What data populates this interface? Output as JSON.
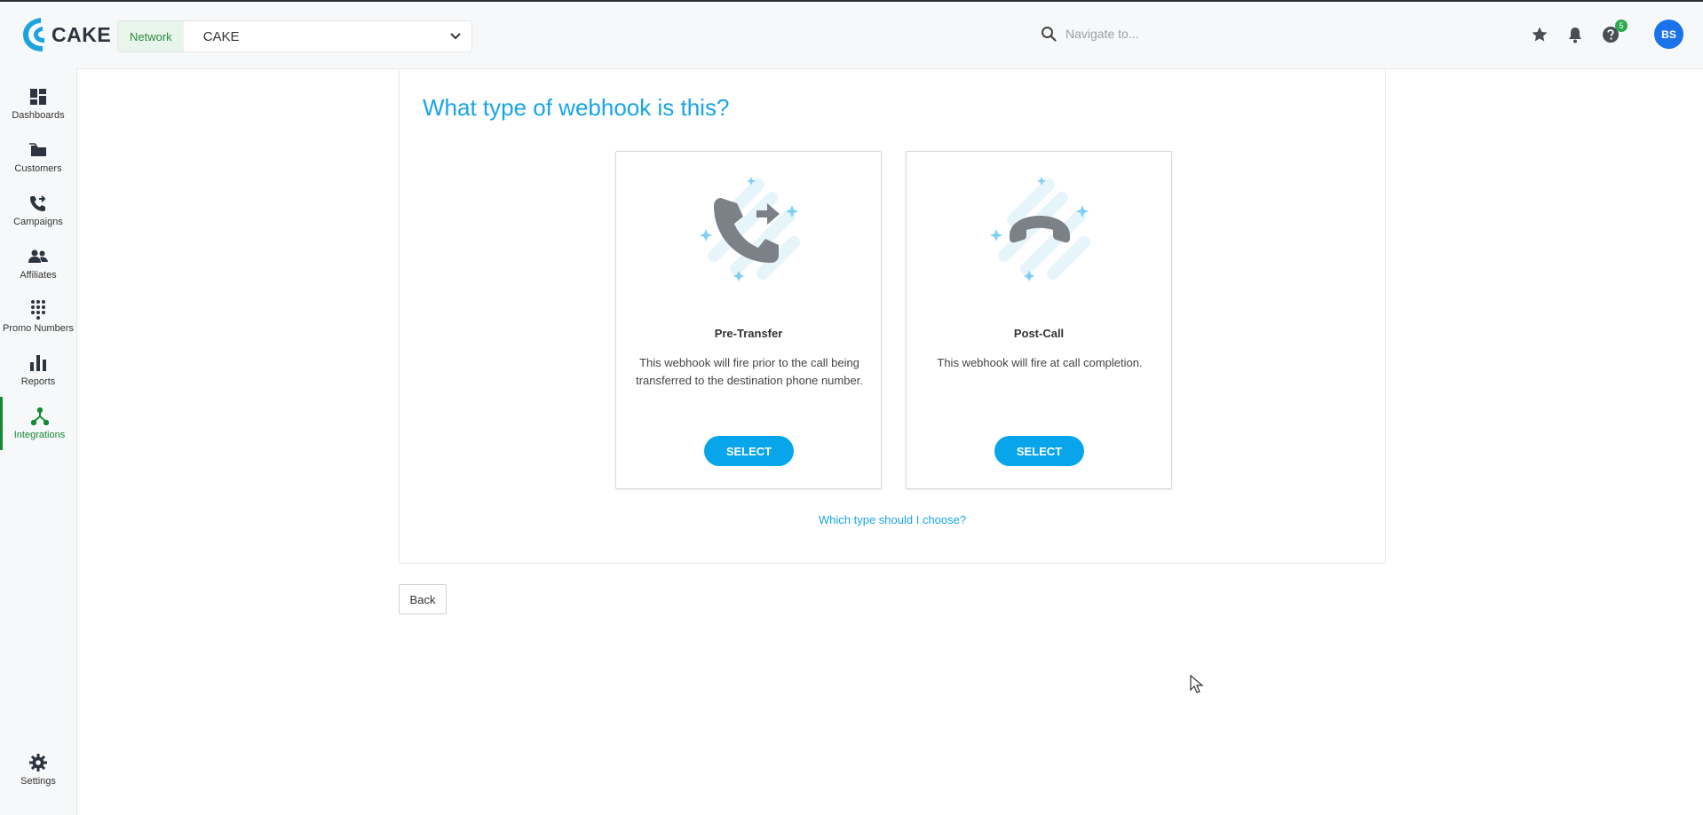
{
  "header": {
    "logo_text": "CAKE",
    "network_label": "Network",
    "network_value": "CAKE",
    "search_placeholder": "Navigate to...",
    "help_badge": "5",
    "avatar_initials": "BS"
  },
  "sidebar": {
    "items": [
      {
        "label": "Dashboards",
        "icon": "dashboard-icon"
      },
      {
        "label": "Customers",
        "icon": "folder-icon"
      },
      {
        "label": "Campaigns",
        "icon": "phone-transfer-icon"
      },
      {
        "label": "Affiliates",
        "icon": "users-icon"
      },
      {
        "label": "Promo Numbers",
        "icon": "dialpad-icon"
      },
      {
        "label": "Reports",
        "icon": "bar-chart-icon"
      },
      {
        "label": "Integrations",
        "icon": "integration-icon",
        "active": true
      }
    ],
    "settings_label": "Settings"
  },
  "main": {
    "title": "What type of webhook is this?",
    "cards": [
      {
        "title": "Pre-Transfer",
        "description": "This webhook will fire prior to the call being transferred to the destination phone number.",
        "button": "SELECT",
        "icon": "phone-transfer-icon"
      },
      {
        "title": "Post-Call",
        "description": "This webhook will fire at call completion.",
        "button": "SELECT",
        "icon": "hang-up-icon"
      }
    ],
    "help_link": "Which type should I choose?",
    "back_button": "Back"
  },
  "colors": {
    "accent": "#08a5ea",
    "active_nav": "#158a36",
    "title": "#17a5e6"
  }
}
